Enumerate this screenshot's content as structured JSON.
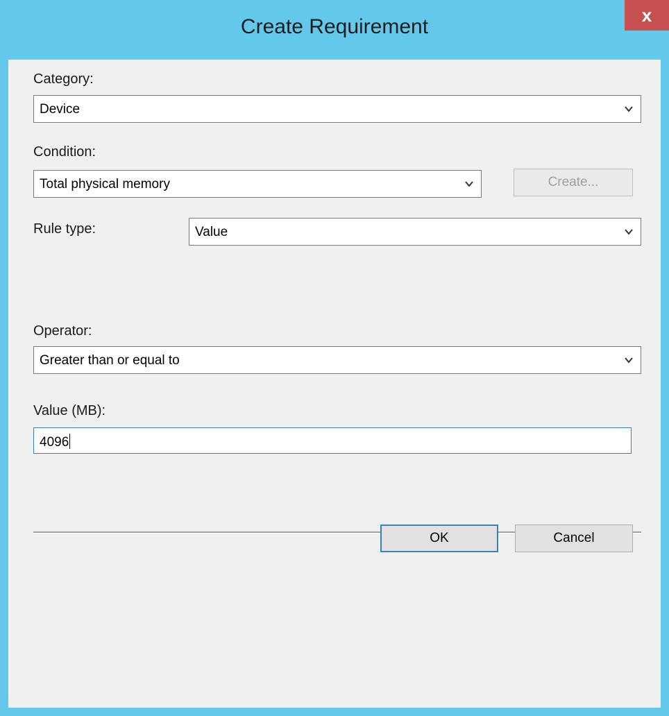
{
  "window": {
    "title": "Create Requirement",
    "close_label": "x"
  },
  "category": {
    "label": "Category:",
    "selected": "Device"
  },
  "condition": {
    "label": "Condition:",
    "selected": "Total physical memory",
    "create_label": "Create..."
  },
  "rule_type": {
    "label": "Rule type:",
    "selected": "Value"
  },
  "operator": {
    "label": "Operator:",
    "selected": "Greater than or equal to"
  },
  "value": {
    "label": "Value (MB):",
    "text": "4096"
  },
  "footer": {
    "ok_label": "OK",
    "cancel_label": "Cancel"
  },
  "colors": {
    "titlebar": "#63c8ea",
    "close": "#c75050",
    "focus_border": "#3c7fb1"
  }
}
